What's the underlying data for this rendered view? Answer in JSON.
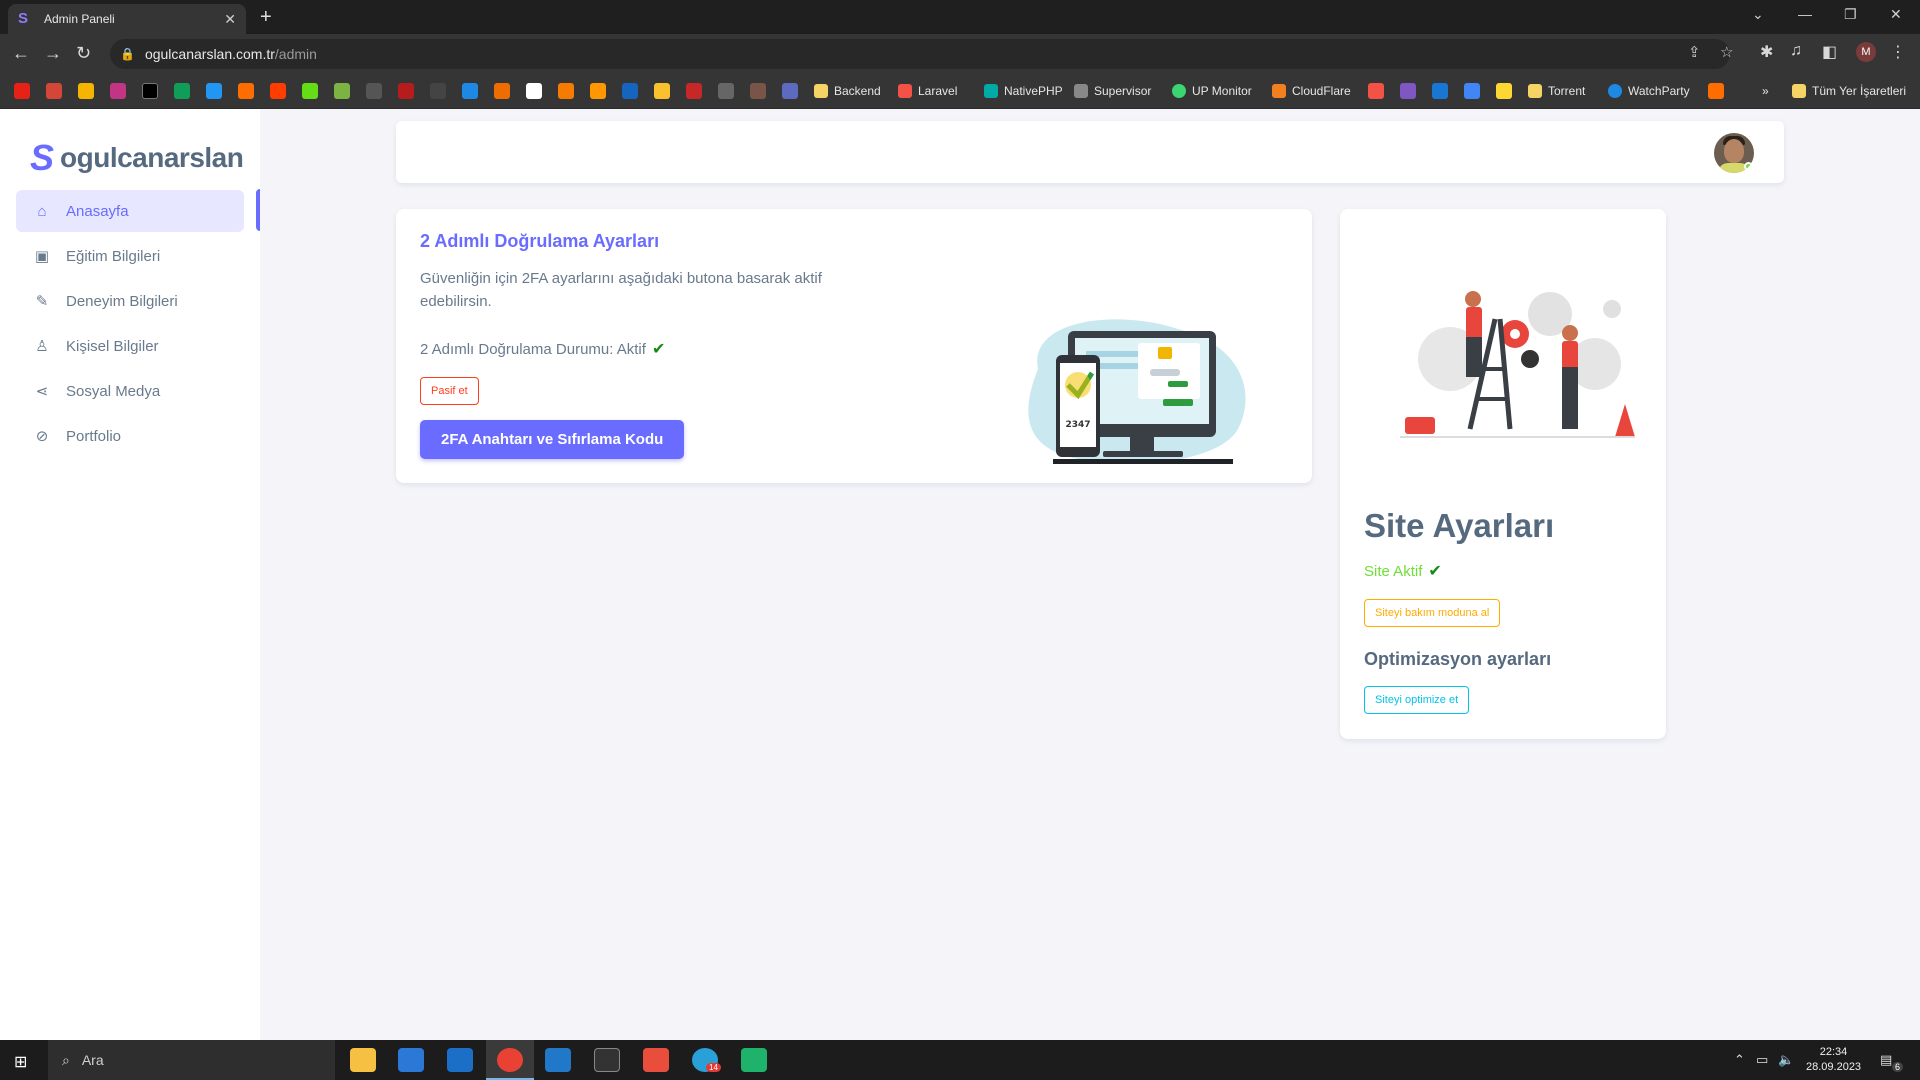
{
  "browser": {
    "tab_title": "Admin Paneli",
    "url_host": "ogulcanarslan.com.tr",
    "url_path": "/admin",
    "profile_initial": "M",
    "bookmarks": [
      "Backend",
      "Laravel",
      "NativePHP",
      "Supervisor",
      "UP Monitor",
      "CloudFlare",
      "Torrent",
      "WatchParty"
    ],
    "bookmarks_folder": "Tüm Yer İşaretleri",
    "bookmarks_more": "»"
  },
  "sidebar": {
    "logo_text": "ogulcanarslan",
    "items": [
      {
        "label": "Anasayfa",
        "icon": "home-icon",
        "active": true
      },
      {
        "label": "Eğitim Bilgileri",
        "icon": "education-icon",
        "active": false
      },
      {
        "label": "Deneyim Bilgileri",
        "icon": "experience-icon",
        "active": false
      },
      {
        "label": "Kişisel Bilgiler",
        "icon": "user-icon",
        "active": false
      },
      {
        "label": "Sosyal Medya",
        "icon": "share-icon",
        "active": false
      },
      {
        "label": "Portfolio",
        "icon": "portfolio-icon",
        "active": false
      }
    ]
  },
  "twofa": {
    "title": "2 Adımlı Doğrulama Ayarları",
    "description": "Güvenliğin için 2FA ayarlarını aşağıdaki butona basarak aktif edebilirsin.",
    "status_text": "2 Adımlı Doğrulama Durumu: Aktif",
    "disable_button": "Pasif et",
    "keys_button": "2FA Anahtarı ve Sıfırlama Kodu",
    "phone_code": "2347"
  },
  "site": {
    "title": "Site Ayarları",
    "status_text": "Site Aktif",
    "maintenance_button": "Siteyi bakım moduna al",
    "optimization_title": "Optimizasyon ayarları",
    "optimize_button": "Siteyi optimize et"
  },
  "taskbar": {
    "search_placeholder": "Ara",
    "time": "22:34",
    "date": "28.09.2023",
    "notification_count": "6",
    "telegram_badge": "14"
  },
  "colors": {
    "primary": "#696cff",
    "success": "#71dd37",
    "danger": "#ff3e1d",
    "warning": "#ffab00",
    "info": "#03c3ec"
  }
}
